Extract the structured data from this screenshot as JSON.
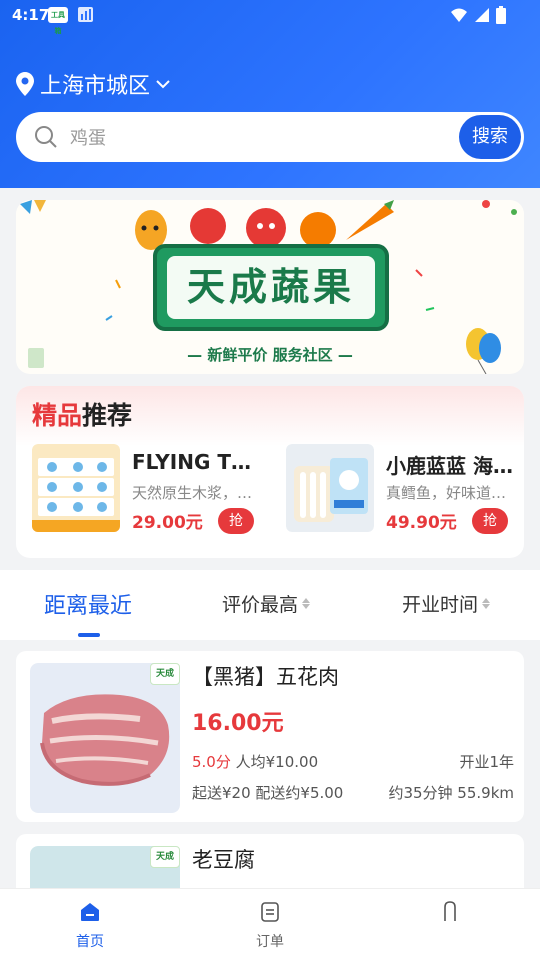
{
  "status_bar": {
    "time": "4:17",
    "app_badge": "工具箱"
  },
  "location": {
    "label": "上海市城区"
  },
  "search": {
    "placeholder": "鸡蛋",
    "button_label": "搜索"
  },
  "banner": {
    "title": "天成蔬果",
    "slogan": "— 新鲜平价 服务社区 —"
  },
  "recommend": {
    "title_highlight": "精品",
    "title_rest": "推荐",
    "items": [
      {
        "name": "FLYING TOTORO…",
        "desc": "天然原生木浆，…",
        "price": "29.00元",
        "action": "抢"
      },
      {
        "name": "小鹿蓝蓝 海…",
        "desc": "真鳕鱼，好味道…",
        "price": "49.90元",
        "action": "抢"
      }
    ]
  },
  "sort_tabs": [
    {
      "label": "距离最近",
      "active": true
    },
    {
      "label": "评价最高",
      "active": false
    },
    {
      "label": "开业时间",
      "active": false
    }
  ],
  "stores": [
    {
      "badge": "天成",
      "title": "【黑猪】五花肉",
      "price": "16.00元",
      "rating": "5.0分",
      "avg": "人均¥10.00",
      "opened": "开业1年",
      "delivery": "起送¥20 配送约¥5.00",
      "eta": "约35分钟 55.9km"
    },
    {
      "badge": "天成",
      "title": "老豆腐"
    }
  ],
  "tabbar": [
    {
      "label": "首页",
      "active": true
    },
    {
      "label": "订单",
      "active": false
    },
    {
      "label": "",
      "active": false
    }
  ],
  "colors": {
    "primary": "#1d5fe9",
    "price_red": "#e6393c"
  }
}
